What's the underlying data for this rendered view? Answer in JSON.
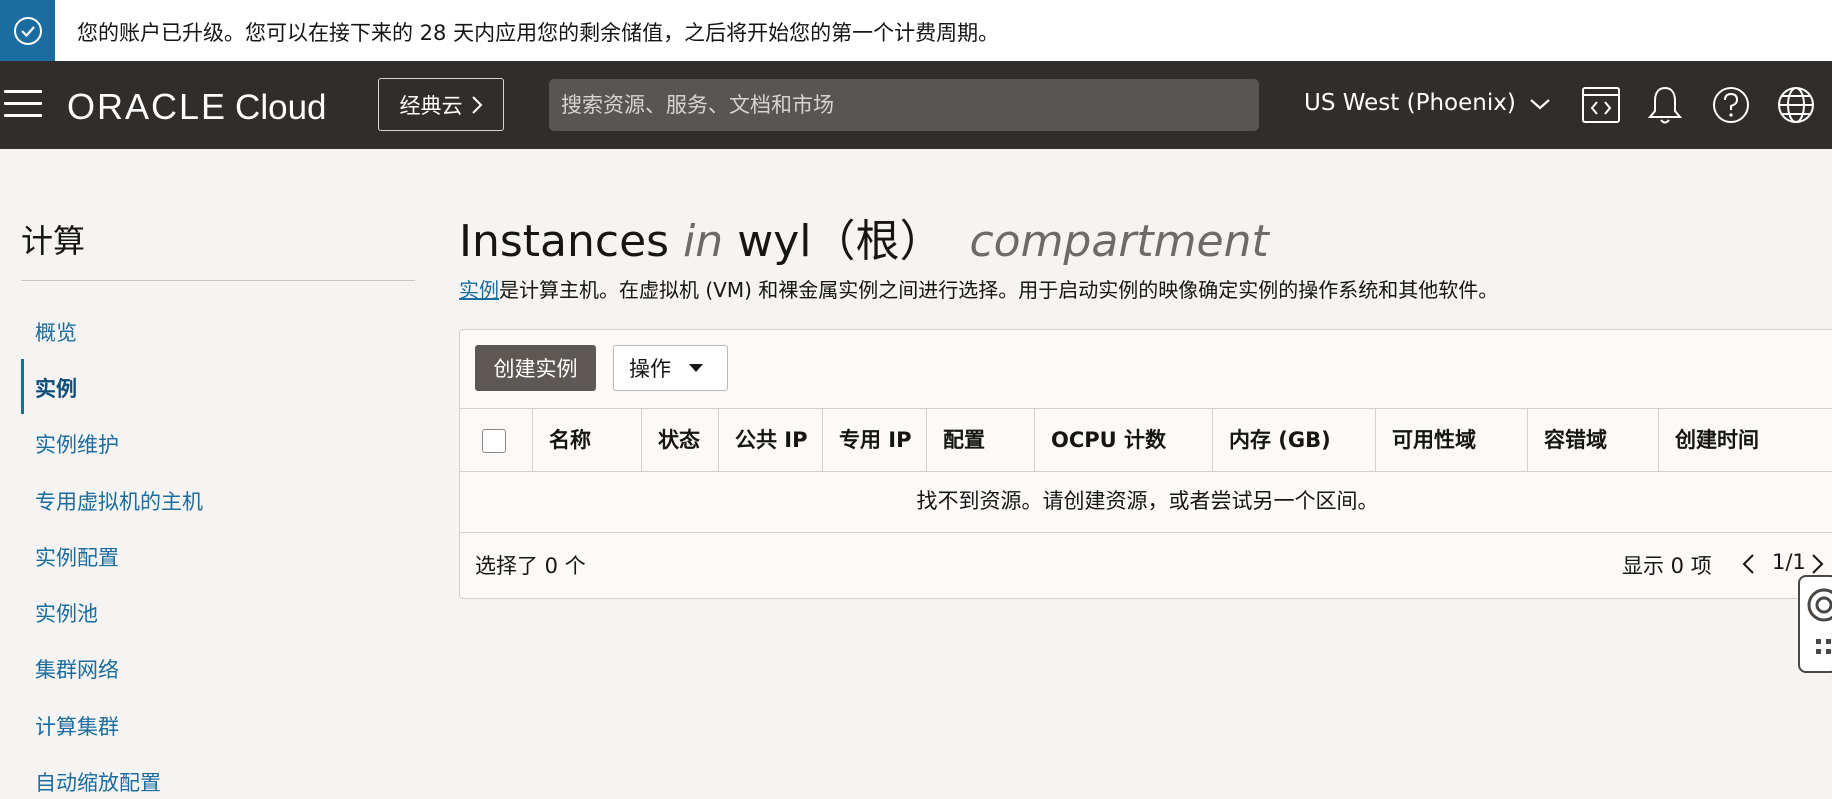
{
  "banner": {
    "text": "您的账户已升级。您可以在接下来的 28 天内应用您的剩余储值，之后将开始您的第一个计费周期。"
  },
  "header": {
    "logo_oracle": "ORACLE",
    "logo_cloud": "Cloud",
    "classic_label": "经典云",
    "search_placeholder": "搜索资源、服务、文档和市场",
    "region": "US West (Phoenix)"
  },
  "sidebar": {
    "title": "计算",
    "items": [
      {
        "label": "概览"
      },
      {
        "label": "实例"
      },
      {
        "label": "实例维护"
      },
      {
        "label": "专用虚拟机的主机"
      },
      {
        "label": "实例配置"
      },
      {
        "label": "实例池"
      },
      {
        "label": "集群网络"
      },
      {
        "label": "计算集群"
      },
      {
        "label": "自动缩放配置"
      }
    ]
  },
  "main": {
    "title_main": "Instances",
    "title_in": "in",
    "title_compartment_name": "wyl（根）",
    "title_compartment": "compartment",
    "desc_link": "实例",
    "desc_rest": "是计算主机。在虚拟机 (VM) 和裸金属实例之间进行选择。用于启动实例的映像确定实例的操作系统和其他软件。",
    "create_button": "创建实例",
    "actions_button": "操作",
    "columns": [
      "名称",
      "状态",
      "公共 IP",
      "专用 IP",
      "配置",
      "OCPU 计数",
      "内存 (GB)",
      "可用性域",
      "容错域",
      "创建时间"
    ],
    "empty_message": "找不到资源。请创建资源，或者尝试另一个区间。",
    "selected_text": "选择了 0 个",
    "showing_text": "显示 0 项",
    "page_indicator": "1/1"
  },
  "colors": {
    "header_bg": "#312d2a",
    "banner_accent": "#1a6d9e",
    "link": "#1a6d9e",
    "primary_button": "#5d5854"
  }
}
